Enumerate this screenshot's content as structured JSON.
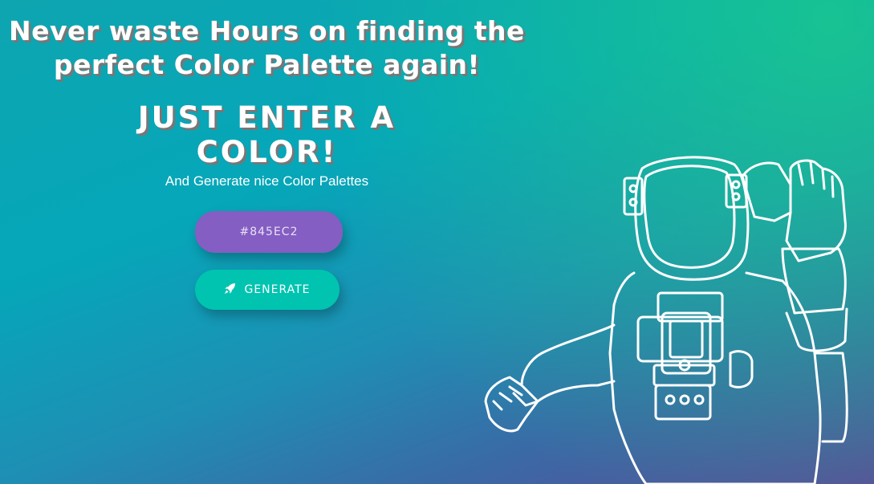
{
  "hero": {
    "headline_line1": "Never waste Hours on finding the",
    "headline_line2": "perfect Color Palette again!",
    "subheadline_line1": "JUST ENTER A",
    "subheadline_line2": "COLOR!",
    "tagline": "And Generate nice Color Palettes"
  },
  "form": {
    "color_value": "#845EC2",
    "generate_label": "GENERATE",
    "generate_icon": "rocket-icon"
  },
  "colors": {
    "input_bg": "#845EC2",
    "button_bg": "#00c4b0",
    "gradient_top_right": "#1ac88c",
    "gradient_bottom_left": "#5b4c98"
  }
}
